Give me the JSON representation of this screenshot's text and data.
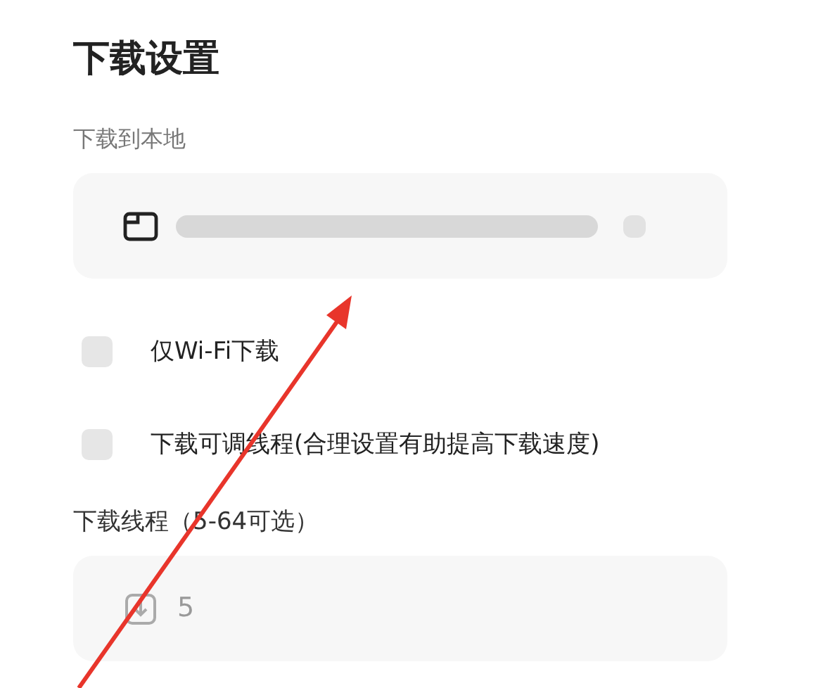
{
  "title": "下载设置",
  "download_location": {
    "label": "下载到本地"
  },
  "options": [
    {
      "label": "仅Wi-Fi下载",
      "checked": false
    },
    {
      "label": "下载可调线程(合理设置有助提高下载速度)",
      "checked": false
    }
  ],
  "threads": {
    "label": "下载线程（5-64可选）",
    "value": "5"
  }
}
